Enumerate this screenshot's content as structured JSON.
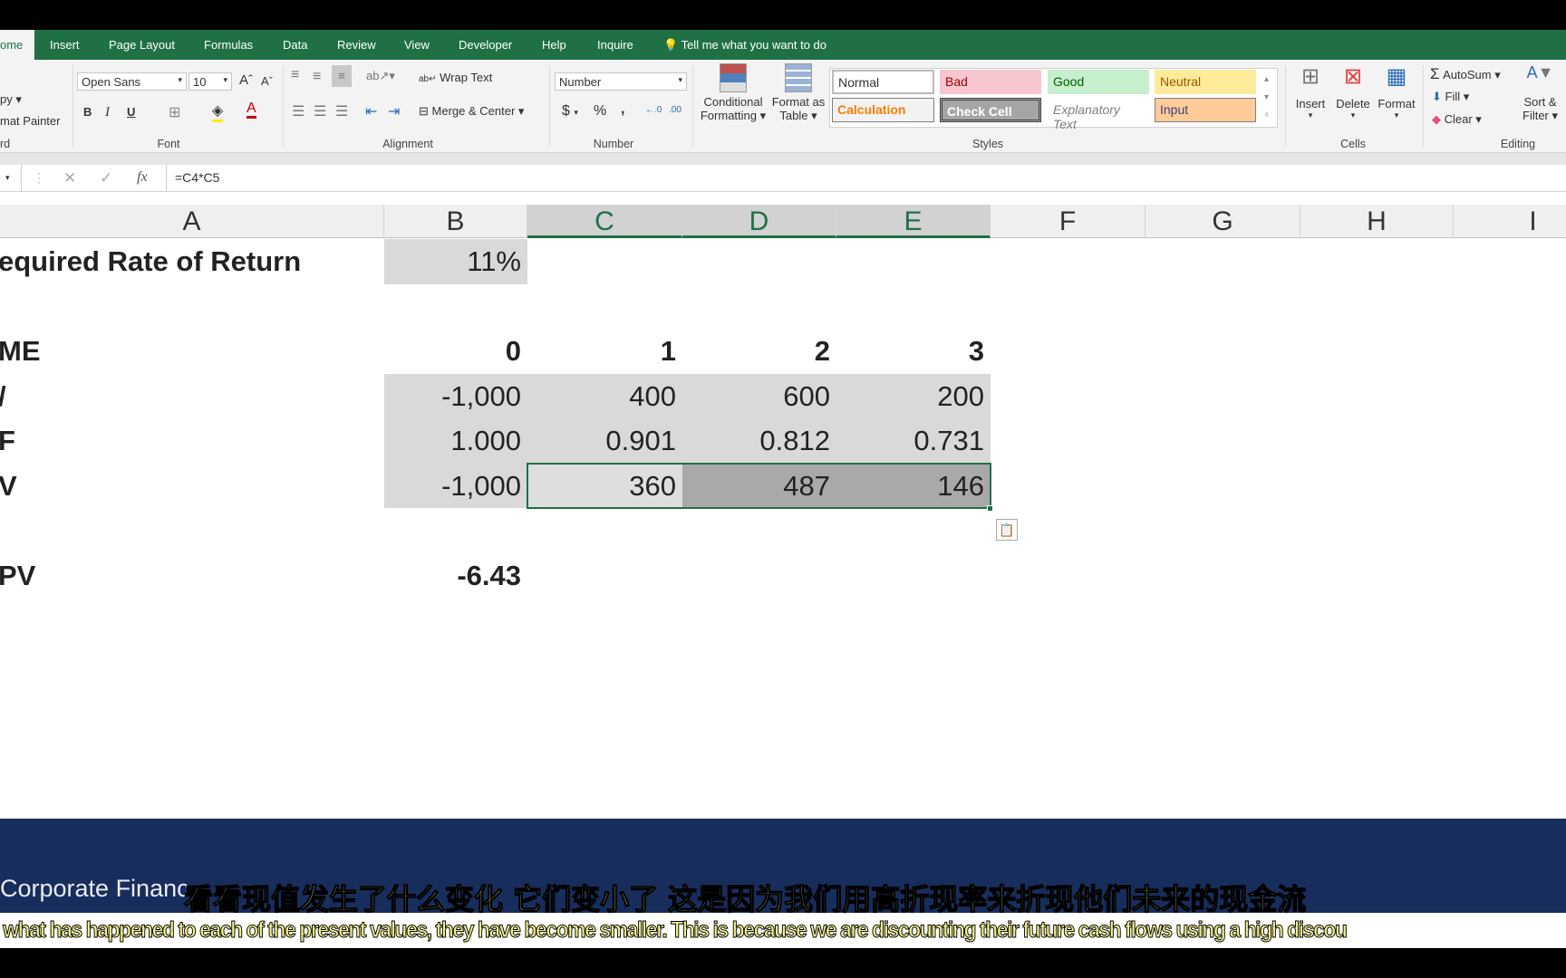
{
  "tabs": [
    "ome",
    "Insert",
    "Page Layout",
    "Formulas",
    "Data",
    "Review",
    "View",
    "Developer",
    "Help",
    "Inquire"
  ],
  "tell_me": "Tell me what you want to do",
  "ribbon": {
    "clipboard": {
      "copy": "py ▾",
      "format_painter": "mat Painter",
      "label": "rd"
    },
    "font": {
      "name": "Open Sans",
      "size": "10",
      "bold": "B",
      "italic": "I",
      "underline": "U",
      "grow": "Aˆ",
      "shrink": "Aˇ",
      "label": "Font"
    },
    "alignment": {
      "wrap": "Wrap Text",
      "merge": "Merge & Center",
      "label": "Alignment"
    },
    "number": {
      "format": "Number",
      "currency": "$",
      "percent": "%",
      "comma": ",",
      "inc": "←.0",
      "dec": ".00",
      "label": "Number"
    },
    "conditional": [
      "Conditional",
      "Formatting ▾"
    ],
    "format_table": [
      "Format as",
      "Table ▾"
    ],
    "styles": {
      "items": [
        "Normal",
        "Bad",
        "Good",
        "Neutral",
        "Calculation",
        "Check Cell",
        "Explanatory Text",
        "Input"
      ],
      "label": "Styles"
    },
    "cells": {
      "insert": "Insert",
      "delete": "Delete",
      "format": "Format",
      "label": "Cells"
    },
    "editing": {
      "autosum": "AutoSum",
      "fill": "Fill ▾",
      "clear": "Clear ▾",
      "sort": [
        "Sort &",
        "Filter ▾"
      ],
      "label": "Editing"
    }
  },
  "formula_bar": {
    "formula": "=C4*C5",
    "fx": "fx"
  },
  "columns": [
    "A",
    "B",
    "C",
    "D",
    "E",
    "F",
    "G",
    "H",
    "I"
  ],
  "rows": [
    {
      "a": "equired Rate of Return",
      "b": "11%"
    },
    {},
    {
      "a": "ME",
      "b": "0",
      "c": "1",
      "d": "2",
      "e": "3"
    },
    {
      "a": "/",
      "b": "-1,000",
      "c": "400",
      "d": "600",
      "e": "200"
    },
    {
      "a": "F",
      "b": "1.000",
      "c": "0.901",
      "d": "0.812",
      "e": "0.731"
    },
    {
      "a": "V",
      "b": "-1,000",
      "c": "360",
      "d": "487",
      "e": "146"
    },
    {},
    {
      "a": "PV",
      "b": "-6.43"
    }
  ],
  "footer": {
    "brand": "Corporate Financ"
  },
  "subtitles": {
    "zh": "看看现值发生了什么变化  它们变小了  这是因为我们用高折现率来折现他们未来的现金流",
    "en": "t what has happened to each of the present values, they have become smaller. This is because we are discounting their future cash flows using a high discou"
  },
  "colors": {
    "excel_green": "#1f7145",
    "footer_blue": "#172d5b",
    "subtitle_yellow": "#f2f08a"
  }
}
